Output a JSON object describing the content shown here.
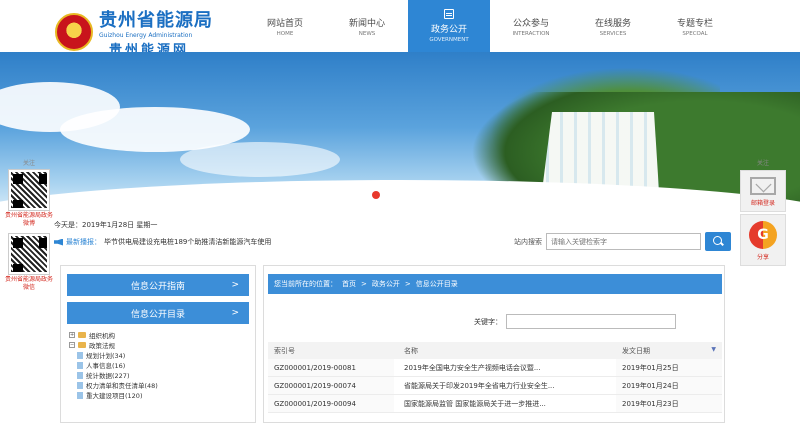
{
  "logo": {
    "title": "贵州省能源局",
    "en": "Guizhou Energy Administration",
    "subtitle": "贵州能源网"
  },
  "nav": [
    {
      "cn": "网站首页",
      "en": "HOME"
    },
    {
      "cn": "新闻中心",
      "en": "NEWS"
    },
    {
      "cn": "政务公开",
      "en": "GOVERNMENT"
    },
    {
      "cn": "公众参与",
      "en": "INTERACTION"
    },
    {
      "cn": "在线服务",
      "en": "SERVICES"
    },
    {
      "cn": "专题专栏",
      "en": "SPECOAL"
    }
  ],
  "side_left": {
    "header": "关注",
    "qr1_label": "贵州省能源局政务微博",
    "qr2_label": "贵州省能源局政务微信"
  },
  "side_right": {
    "header": "关注",
    "mail_label": "邮箱登录",
    "share_label": "分享"
  },
  "date_text": "今天是：2019年1月28日 星期一",
  "notice": {
    "label": "最新播报：",
    "text": "毕节供电局建设充电桩189个助推清洁新能源汽车使用"
  },
  "search": {
    "label": "站内搜索",
    "placeholder": "请输入关键检索字"
  },
  "left_panel": {
    "btn1": "信息公开指南",
    "btn2": "信息公开目录",
    "tree": [
      {
        "label": "组织机构",
        "type": "folder"
      },
      {
        "label": "政策法规",
        "type": "folder"
      },
      {
        "label": "规划计划(34)",
        "type": "doc"
      },
      {
        "label": "人事信息(16)",
        "type": "doc"
      },
      {
        "label": "统计数据(227)",
        "type": "doc"
      },
      {
        "label": "权力清单和责任清单(48)",
        "type": "doc"
      },
      {
        "label": "重大建设项目(120)",
        "type": "doc"
      }
    ]
  },
  "right_panel": {
    "crumb_prefix": "您当前所在的位置：",
    "crumb_home": "首页",
    "crumb_1": "政务公开",
    "crumb_2": "信息公开目录",
    "sep": ">",
    "keyword_label": "关键字：",
    "columns": [
      "索引号",
      "名称",
      "发文日期"
    ],
    "rows": [
      [
        "GZ000001/2019-00081",
        "2019年全国电力安全生产视频电话会议暨...",
        "2019年01月25日"
      ],
      [
        "GZ000001/2019-00074",
        "省能源局关于印发2019年全省电力行业安全生...",
        "2019年01月24日"
      ],
      [
        "GZ000001/2019-00094",
        "国家能源局监管 国家能源局关于进一步推进...",
        "2019年01月23日"
      ]
    ]
  }
}
